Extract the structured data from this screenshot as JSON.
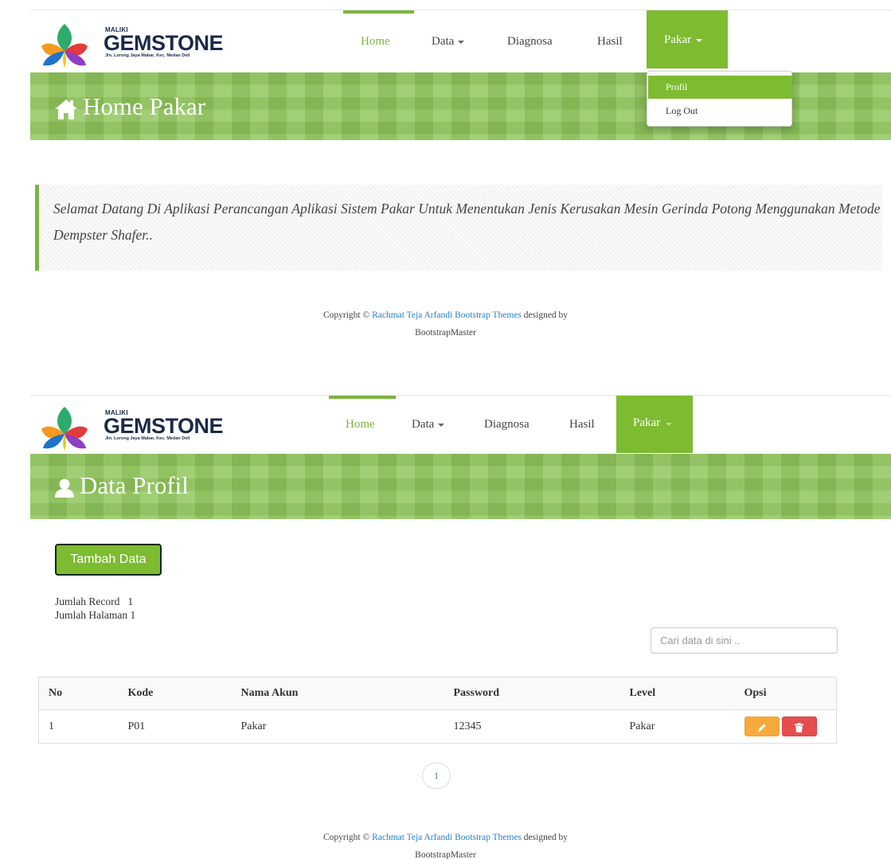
{
  "brand": {
    "top_line": "MALIKI",
    "name": "GEMSTONE",
    "address": "Jln. Lorong Jaya Mabar, Kec. Medan Deli"
  },
  "nav": {
    "home": "Home",
    "data": "Data",
    "diagnosa": "Diagnosa",
    "hasil": "Hasil",
    "pakar": "Pakar"
  },
  "colors": {
    "accent": "#7dbb30",
    "banner": "#8fc65a",
    "edit": "#f7a93b",
    "delete": "#e64d4d",
    "link": "#2a7fc1"
  },
  "screen1": {
    "banner_icon": "home-icon",
    "banner_title": "Home Pakar",
    "dropdown": [
      "Profil",
      "Log Out"
    ],
    "welcome_text": "Selamat Datang Di Aplikasi Perancangan Aplikasi Sistem Pakar Untuk Menentukan Jenis Kerusakan Mesin Gerinda Potong Menggunakan Metode Dempster Shafer.."
  },
  "screen2": {
    "banner_icon": "user-icon",
    "banner_title": "Data Profil",
    "add_button": "Tambah Data",
    "jumlah_record_label": "Jumlah Record",
    "jumlah_record_value": "1",
    "jumlah_halaman_label": "Jumlah Halaman",
    "jumlah_halaman_value": "1",
    "search_placeholder": "Cari data di sini ..",
    "table": {
      "columns": [
        "No",
        "Kode",
        "Nama Akun",
        "Password",
        "Level",
        "Opsi"
      ],
      "rows": [
        [
          "1",
          "P01",
          "Pakar",
          "12345",
          "Pakar"
        ]
      ]
    },
    "pagination": [
      "1"
    ],
    "edit_icon": "pencil-icon",
    "delete_icon": "trash-icon"
  },
  "footer": {
    "prefix": "Copyright ©",
    "link": "Rachmat Teja Arfandi Bootstrap Themes",
    "middle": "designed by",
    "suffix": "BootstrapMaster"
  }
}
